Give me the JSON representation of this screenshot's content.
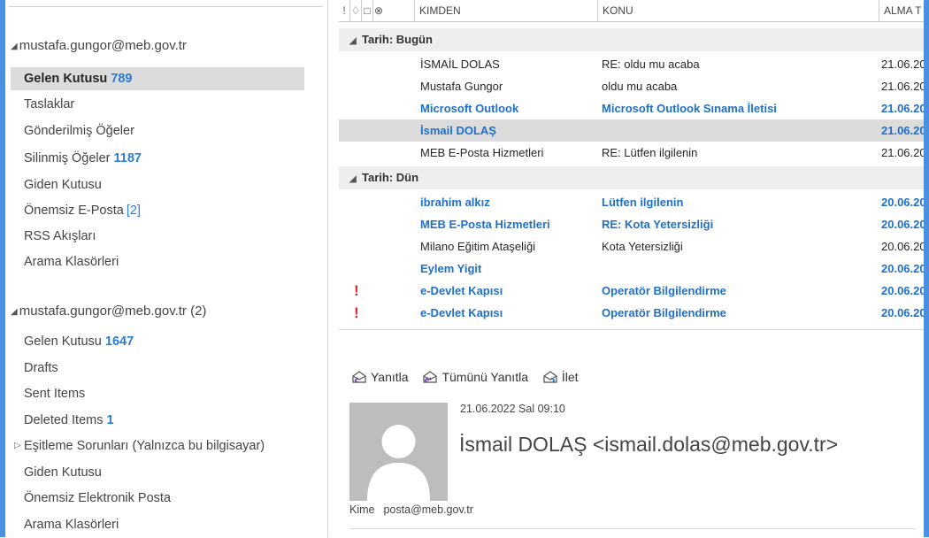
{
  "folder_pane": {
    "accounts": [
      {
        "name": "mustafa.gungor@meb.gov.tr",
        "count": "",
        "folders": [
          {
            "label": "Gelen Kutusu",
            "count": "789",
            "count_style": "bold",
            "selected": true
          },
          {
            "label": "Taslaklar",
            "count": ""
          },
          {
            "label": "Gönderilmiş Öğeler",
            "count": ""
          },
          {
            "label": "Silinmiş Öğeler",
            "count": "1187",
            "count_style": "bold"
          },
          {
            "label": "Giden Kutusu",
            "count": ""
          },
          {
            "label": "Önemsiz E-Posta",
            "count": "[2]",
            "count_style": "plain"
          },
          {
            "label": "RSS Akışları",
            "count": ""
          },
          {
            "label": "Arama Klasörleri",
            "count": ""
          }
        ]
      },
      {
        "name": "mustafa.gungor@meb.gov.tr",
        "count": "(2)",
        "folders": [
          {
            "label": "Gelen Kutusu",
            "count": "1647",
            "count_style": "bold"
          },
          {
            "label": "Drafts",
            "count": ""
          },
          {
            "label": "Sent Items",
            "count": ""
          },
          {
            "label": "Deleted Items",
            "count": "1",
            "count_style": "bold"
          },
          {
            "label": "Eşitleme Sorunları (Yalnızca bu bilgisayar)",
            "count": "",
            "expandable": true
          },
          {
            "label": "Giden Kutusu",
            "count": ""
          },
          {
            "label": "Önemsiz Elektronik Posta",
            "count": ""
          },
          {
            "label": "Arama Klasörleri",
            "count": ""
          }
        ]
      }
    ]
  },
  "message_list": {
    "columns": {
      "from": "KIMDEN",
      "subject": "KONU",
      "received": "ALMA T"
    },
    "groups": [
      {
        "label": "Tarih: Bugün",
        "messages": [
          {
            "from": "İSMAİL DOLAS",
            "subject": "RE: oldu mu acaba",
            "date": "21.06.20",
            "unread": false,
            "important": false,
            "selected": false
          },
          {
            "from": "Mustafa Gungor",
            "subject": "oldu mu acaba",
            "date": "21.06.20",
            "unread": false,
            "important": false,
            "selected": false
          },
          {
            "from": "Microsoft Outlook",
            "subject": "Microsoft Outlook Sınama İletisi",
            "date": "21.06.20",
            "unread": true,
            "important": false,
            "selected": false
          },
          {
            "from": "İsmail DOLAŞ",
            "subject": "",
            "date": "21.06.20",
            "unread": true,
            "important": false,
            "selected": true
          },
          {
            "from": "MEB E-Posta Hizmetleri",
            "subject": "RE: Lütfen ilgilenin",
            "date": "21.06.20",
            "unread": false,
            "important": false,
            "selected": false
          }
        ]
      },
      {
        "label": "Tarih: Dün",
        "messages": [
          {
            "from": "ibrahim alkız",
            "subject": "Lütfen ilgilenin",
            "date": "20.06.20",
            "unread": true,
            "important": false,
            "selected": false
          },
          {
            "from": "MEB E-Posta Hizmetleri",
            "subject": "RE: Kota Yetersizliği",
            "date": "20.06.20",
            "unread": true,
            "important": false,
            "selected": false
          },
          {
            "from": "Milano Eğitim Ataşeliği",
            "subject": "Kota Yetersizliği",
            "date": "20.06.20",
            "unread": false,
            "important": false,
            "selected": false
          },
          {
            "from": "Eylem Yigit",
            "subject": "",
            "date": "20.06.20",
            "unread": true,
            "important": false,
            "selected": false
          },
          {
            "from": "e-Devlet Kapısı",
            "subject": "Operatör Bilgilendirme",
            "date": "20.06.20",
            "unread": true,
            "important": true,
            "selected": false
          },
          {
            "from": "e-Devlet Kapısı",
            "subject": "Operatör Bilgilendirme",
            "date": "20.06.20",
            "unread": true,
            "important": true,
            "selected": false
          }
        ]
      }
    ]
  },
  "reading_pane": {
    "actions": {
      "reply": "Yanıtla",
      "reply_all": "Tümünü Yanıtla",
      "forward": "İlet"
    },
    "date": "21.06.2022 Sal 09:10",
    "sender": "İsmail DOLAŞ <ismail.dolas@meb.gov.tr>",
    "to_label": "Kime",
    "to_value": "posta@meb.gov.tr"
  },
  "colors": {
    "unread": "#1f6fcc",
    "count": "#2b7cd3",
    "important": "#d3282a",
    "selection": "#dcdcdc",
    "frame": "#4a90e2"
  }
}
